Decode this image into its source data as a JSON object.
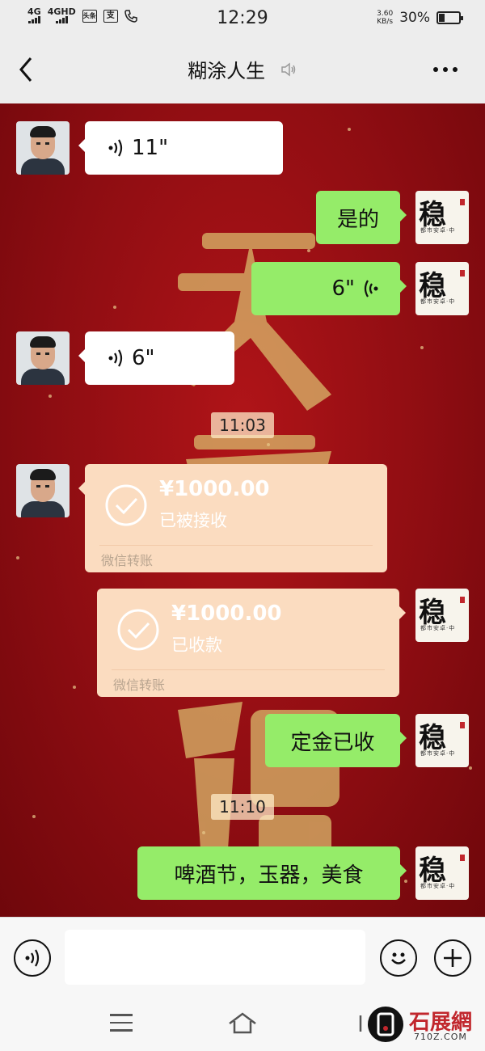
{
  "status_bar": {
    "signal_1": "4G",
    "signal_2": "4GHD",
    "app_icon_1": "头条",
    "app_icon_2": "支",
    "time": "12:29",
    "speed_value": "3.60",
    "speed_unit": "KB/s",
    "battery_percent": "30%",
    "battery_level": 0.3
  },
  "header": {
    "title": "糊涂人生",
    "back_icon": "chevron-left-icon",
    "mute_icon": "voice-mute-icon",
    "more_icon": "more-dots-icon"
  },
  "messages": [
    {
      "side": "left",
      "type": "voice",
      "text": "11\""
    },
    {
      "side": "right",
      "type": "text",
      "text": "是的"
    },
    {
      "side": "right",
      "type": "voice",
      "text": "6\""
    },
    {
      "side": "left",
      "type": "voice",
      "text": "6\""
    },
    {
      "type": "time",
      "text": "11:03"
    },
    {
      "side": "left",
      "type": "transfer",
      "amount": "¥1000.00",
      "state": "已被接收",
      "source": "微信转账"
    },
    {
      "side": "right",
      "type": "transfer",
      "amount": "¥1000.00",
      "state": "已收款",
      "source": "微信转账"
    },
    {
      "side": "right",
      "type": "text",
      "text": "定金已收"
    },
    {
      "type": "time",
      "text": "11:10"
    },
    {
      "side": "right",
      "type": "text",
      "text": "啤酒节，玉器，美食"
    }
  ],
  "avatars": {
    "self_char": "稳",
    "self_small": "都市安卓·中"
  },
  "input_bar": {
    "voice_icon": "voice-input-icon",
    "emoji_icon": "emoji-icon",
    "plus_icon": "plus-icon",
    "value": ""
  },
  "watermark": {
    "text": "石展網",
    "domain": "710Z.COM"
  },
  "colors": {
    "chat_bg": "#9a0f14",
    "self_bubble": "#95ec69",
    "other_bubble": "#ffffff",
    "transfer_card": "#fbdcc0"
  }
}
